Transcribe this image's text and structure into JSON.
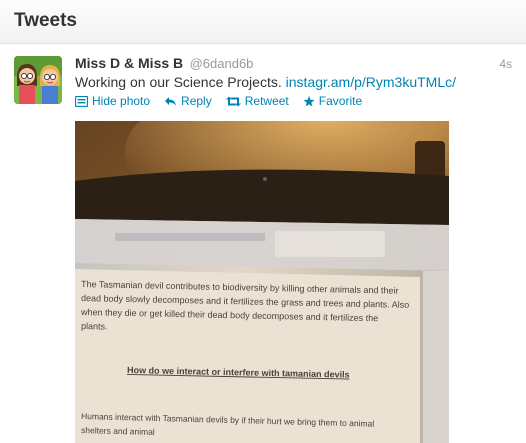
{
  "header": {
    "title": "Tweets"
  },
  "tweet": {
    "fullname": "Miss D & Miss B",
    "screenname": "@6dand6b",
    "timestamp": "4s",
    "text": "Working on our Science Projects.",
    "link_text": "instagr.am/p/Rym3kuTMLc/",
    "actions": {
      "hide_photo": "Hide photo",
      "reply": "Reply",
      "retweet": "Retweet",
      "favorite": "Favorite"
    },
    "photo_text": {
      "paragraph": [
        "The Tasmanian devil contributes to biodiversity by killing other animals and their",
        "dead body slowly decomposes and it fertilizes the grass and trees and plants. Also",
        "when they die or get killed their dead body decomposes and it fertilizes the",
        "plants."
      ],
      "heading": "How do we interact or interfere with tamanian devils",
      "footer": [
        "Humans interact with Tasmanian devils by if their hurt we bring them to animal",
        "shelters and animal"
      ]
    }
  },
  "colors": {
    "link": "#0084b4",
    "muted": "#999999",
    "text": "#333333"
  },
  "icons": {
    "hide_photo": "photo-icon",
    "reply": "reply-icon",
    "retweet": "retweet-icon",
    "favorite": "star-icon"
  }
}
